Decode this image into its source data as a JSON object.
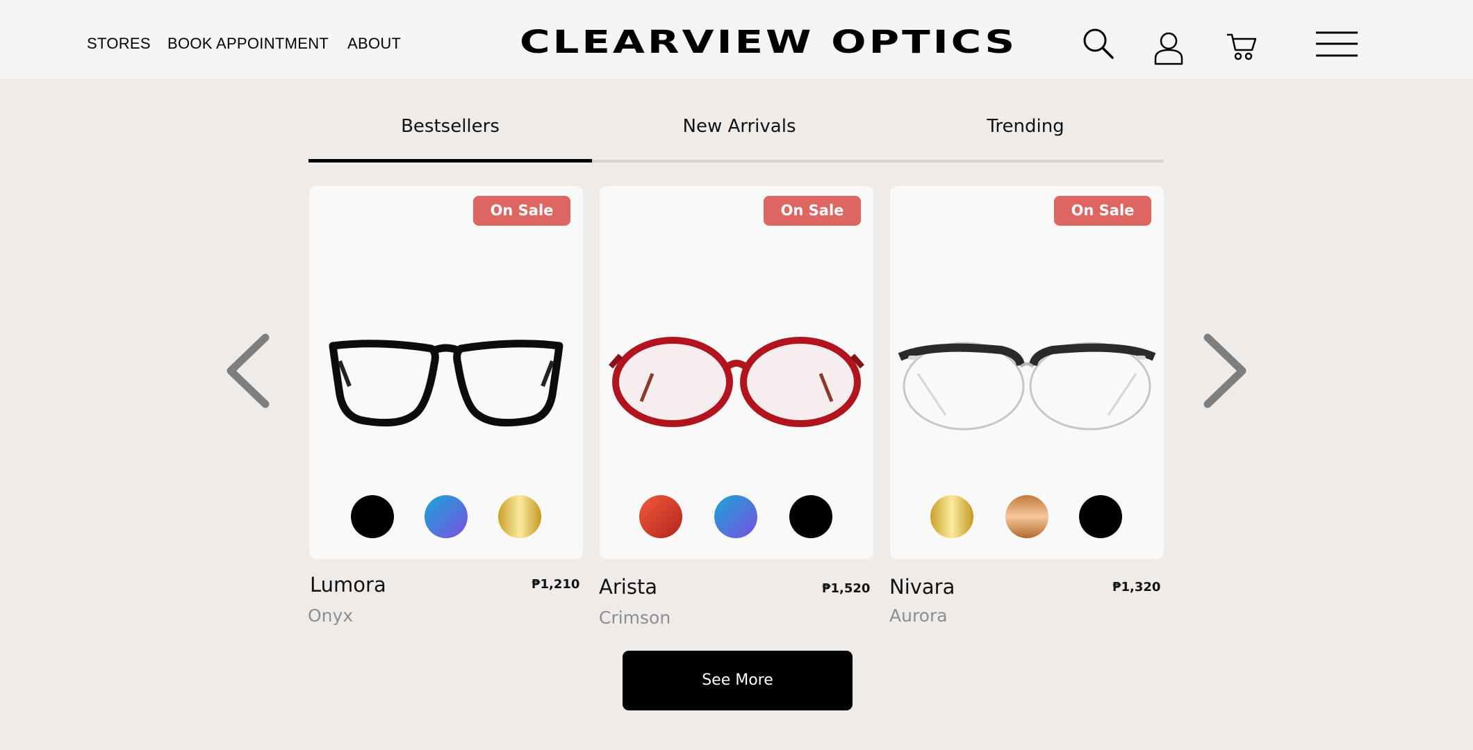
{
  "header": {
    "nav": [
      "STORES",
      "BOOK APPOINTMENT",
      "ABOUT"
    ],
    "brand": "CLEARVIEW OPTICS",
    "icons": [
      "search-icon",
      "user-icon",
      "cart-icon",
      "menu-icon"
    ]
  },
  "tabs": {
    "items": [
      "Bestsellers",
      "New Arrivals",
      "Trending"
    ],
    "active": "Bestsellers"
  },
  "products": [
    {
      "badge": "On Sale",
      "name": "Lumora",
      "price": "₱1,210",
      "color": "Onyx",
      "frame_color": "#111111",
      "swatches": [
        "black",
        "blue-purple",
        "gold"
      ]
    },
    {
      "badge": "On Sale",
      "name": "Arista",
      "price": "₱1,520",
      "color": "Crimson",
      "frame_color": "#b2141e",
      "swatches": [
        "red",
        "blue-purple",
        "black"
      ]
    },
    {
      "badge": "On Sale",
      "name": "Nivara",
      "price": "₱1,320",
      "color": "Aurora",
      "frame_color": "#2a2a2a",
      "swatches": [
        "gold",
        "bronze",
        "black"
      ]
    }
  ],
  "carousel": {
    "prev_icon": "chevron-left-icon",
    "next_icon": "chevron-right-icon"
  },
  "cta": {
    "label": "See More"
  },
  "colors": {
    "badge": "#dd6760",
    "page_background": "#eeebe8",
    "header_background": "#f6f5f3",
    "card_background": "#f9f9f9"
  }
}
